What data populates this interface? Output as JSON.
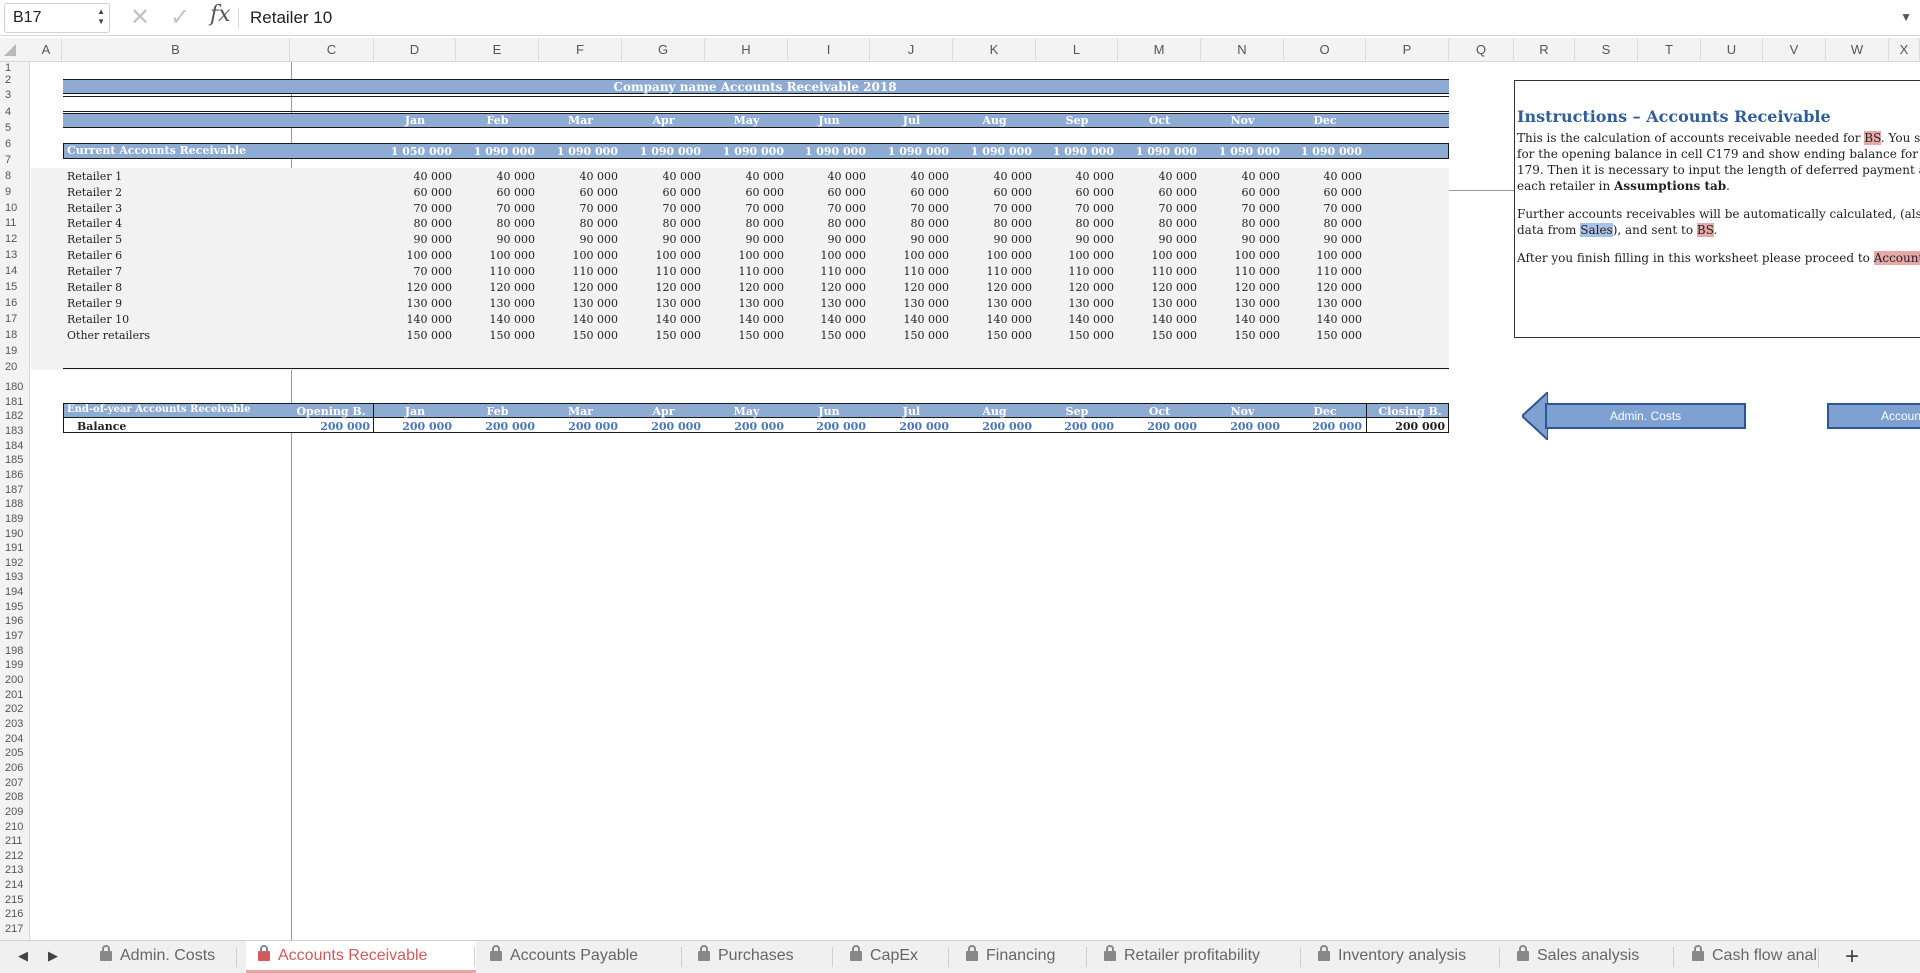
{
  "formula_bar": {
    "name_box": "B17",
    "formula": "Retailer 10",
    "fx": "fx",
    "cancel_glyph": "✕",
    "confirm_glyph": "✓"
  },
  "columns": [
    "A",
    "B",
    "C",
    "D",
    "E",
    "F",
    "G",
    "H",
    "I",
    "J",
    "K",
    "L",
    "M",
    "N",
    "O",
    "P",
    "Q",
    "R",
    "S",
    "T",
    "U",
    "V",
    "W",
    "X"
  ],
  "rows_top": [
    "1",
    "2",
    "3",
    "4",
    "5",
    "6",
    "7",
    "8",
    "9",
    "10",
    "11",
    "12",
    "13",
    "14",
    "15",
    "16",
    "17",
    "18",
    "19",
    "20"
  ],
  "rows_bottom_start": 180,
  "rows_bottom_end": 217,
  "sheet": {
    "title": "Company name Accounts Receivable 2018",
    "months": [
      "Jan",
      "Feb",
      "Mar",
      "Apr",
      "May",
      "Jun",
      "Jul",
      "Aug",
      "Sep",
      "Oct",
      "Nov",
      "Dec"
    ],
    "current": {
      "label": "Current Accounts Receivable",
      "values": [
        "1 050 000",
        "1 090 000",
        "1 090 000",
        "1 090 000",
        "1 090 000",
        "1 090 000",
        "1 090 000",
        "1 090 000",
        "1 090 000",
        "1 090 000",
        "1 090 000",
        "1 090 000"
      ]
    },
    "retailers": [
      {
        "name": "Retailer 1",
        "values": [
          "40 000",
          "40 000",
          "40 000",
          "40 000",
          "40 000",
          "40 000",
          "40 000",
          "40 000",
          "40 000",
          "40 000",
          "40 000",
          "40 000"
        ]
      },
      {
        "name": "Retailer 2",
        "values": [
          "60 000",
          "60 000",
          "60 000",
          "60 000",
          "60 000",
          "60 000",
          "60 000",
          "60 000",
          "60 000",
          "60 000",
          "60 000",
          "60 000"
        ]
      },
      {
        "name": "Retailer 3",
        "values": [
          "70 000",
          "70 000",
          "70 000",
          "70 000",
          "70 000",
          "70 000",
          "70 000",
          "70 000",
          "70 000",
          "70 000",
          "70 000",
          "70 000"
        ]
      },
      {
        "name": "Retailer 4",
        "values": [
          "80 000",
          "80 000",
          "80 000",
          "80 000",
          "80 000",
          "80 000",
          "80 000",
          "80 000",
          "80 000",
          "80 000",
          "80 000",
          "80 000"
        ]
      },
      {
        "name": "Retailer 5",
        "values": [
          "90 000",
          "90 000",
          "90 000",
          "90 000",
          "90 000",
          "90 000",
          "90 000",
          "90 000",
          "90 000",
          "90 000",
          "90 000",
          "90 000"
        ]
      },
      {
        "name": "Retailer 6",
        "values": [
          "100 000",
          "100 000",
          "100 000",
          "100 000",
          "100 000",
          "100 000",
          "100 000",
          "100 000",
          "100 000",
          "100 000",
          "100 000",
          "100 000"
        ]
      },
      {
        "name": "Retailer 7",
        "values": [
          "70 000",
          "110 000",
          "110 000",
          "110 000",
          "110 000",
          "110 000",
          "110 000",
          "110 000",
          "110 000",
          "110 000",
          "110 000",
          "110 000"
        ]
      },
      {
        "name": "Retailer 8",
        "values": [
          "120 000",
          "120 000",
          "120 000",
          "120 000",
          "120 000",
          "120 000",
          "120 000",
          "120 000",
          "120 000",
          "120 000",
          "120 000",
          "120 000"
        ]
      },
      {
        "name": "Retailer 9",
        "values": [
          "130 000",
          "130 000",
          "130 000",
          "130 000",
          "130 000",
          "130 000",
          "130 000",
          "130 000",
          "130 000",
          "130 000",
          "130 000",
          "130 000"
        ]
      },
      {
        "name": "Retailer 10",
        "values": [
          "140 000",
          "140 000",
          "140 000",
          "140 000",
          "140 000",
          "140 000",
          "140 000",
          "140 000",
          "140 000",
          "140 000",
          "140 000",
          "140 000"
        ]
      },
      {
        "name": "Other retailers",
        "values": [
          "150 000",
          "150 000",
          "150 000",
          "150 000",
          "150 000",
          "150 000",
          "150 000",
          "150 000",
          "150 000",
          "150 000",
          "150 000",
          "150 000"
        ]
      }
    ],
    "eoy": {
      "label": "End-of-year Accounts Receivable",
      "opening_label": "Opening B.",
      "closing_label": "Closing B.",
      "balance_label": "Balance",
      "opening_value": "200 000",
      "values": [
        "200 000",
        "200 000",
        "200 000",
        "200 000",
        "200 000",
        "200 000",
        "200 000",
        "200 000",
        "200 000",
        "200 000",
        "200 000",
        "200 000"
      ],
      "closing_value": "200 000"
    }
  },
  "instructions": {
    "title": "Instructions – Accounts Receivable",
    "p1_a": "This is the calculation of accounts receivable needed for ",
    "p1_bs": "BS",
    "p1_b": ". You sh",
    "p1_l2": "for the opening balance in cell C179 and show ending balance for e",
    "p1_l3": "179. Then it is necessary to input the length of deferred payment a",
    "p1_l4_a": "each retailer in ",
    "p1_l4_b": "Assumptions tab",
    "p1_l4_c": ".",
    "p2_l1": "Further accounts receivables will be automatically calculated, (also",
    "p2_l2_a": "data from ",
    "p2_l2_sales": "Sales",
    "p2_l2_b": "), and sent to ",
    "p2_l2_bs": "BS",
    "p2_l2_c": ".",
    "p3_a": "After you finish filling in this worksheet please proceed to ",
    "p3_b": "Account"
  },
  "nav": {
    "prev_label": "Admin. Costs",
    "next_label": "Accoun"
  },
  "tabs": [
    {
      "label": "Admin. Costs",
      "active": false
    },
    {
      "label": "Accounts Receivable",
      "active": true
    },
    {
      "label": "Accounts Payable",
      "active": false
    },
    {
      "label": "Purchases",
      "active": false
    },
    {
      "label": "CapEx",
      "active": false
    },
    {
      "label": "Financing",
      "active": false
    },
    {
      "label": "Retailer profitability",
      "active": false
    },
    {
      "label": "Inventory analysis",
      "active": false
    },
    {
      "label": "Sales analysis",
      "active": false
    },
    {
      "label": "Cash flow anal",
      "active": false
    }
  ],
  "tab_nav": {
    "prev": "◀",
    "next": "▶",
    "add": "+"
  },
  "colors": {
    "band": "#8eabd3",
    "active_tab": "#d35a5a",
    "value_blue": "#4a76c0",
    "instr_title": "#2e5f9a"
  }
}
